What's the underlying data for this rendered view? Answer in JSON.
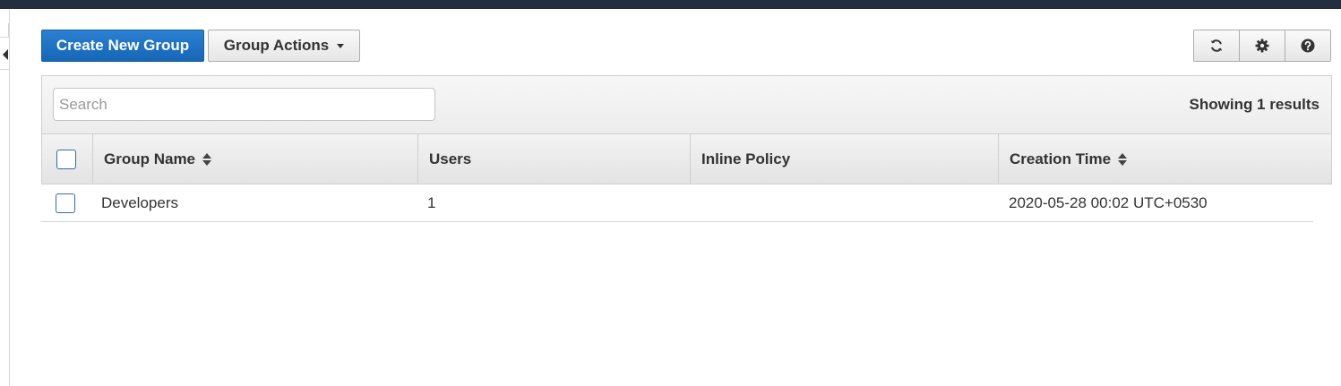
{
  "toolbar": {
    "create_label": "Create New Group",
    "actions_label": "Group Actions",
    "icons": [
      "refresh-icon",
      "gear-icon",
      "help-icon"
    ]
  },
  "filter": {
    "search_placeholder": "Search",
    "search_value": "",
    "results_text": "Showing 1 results"
  },
  "table": {
    "columns": [
      "Group Name",
      "Users",
      "Inline Policy",
      "Creation Time"
    ],
    "rows": [
      {
        "group_name": "Developers",
        "users": "1",
        "inline_policy": "",
        "creation_time": "2020-05-28 00:02 UTC+0530"
      }
    ]
  },
  "colors": {
    "primary": "#1566b7",
    "topbar": "#232f3e"
  }
}
